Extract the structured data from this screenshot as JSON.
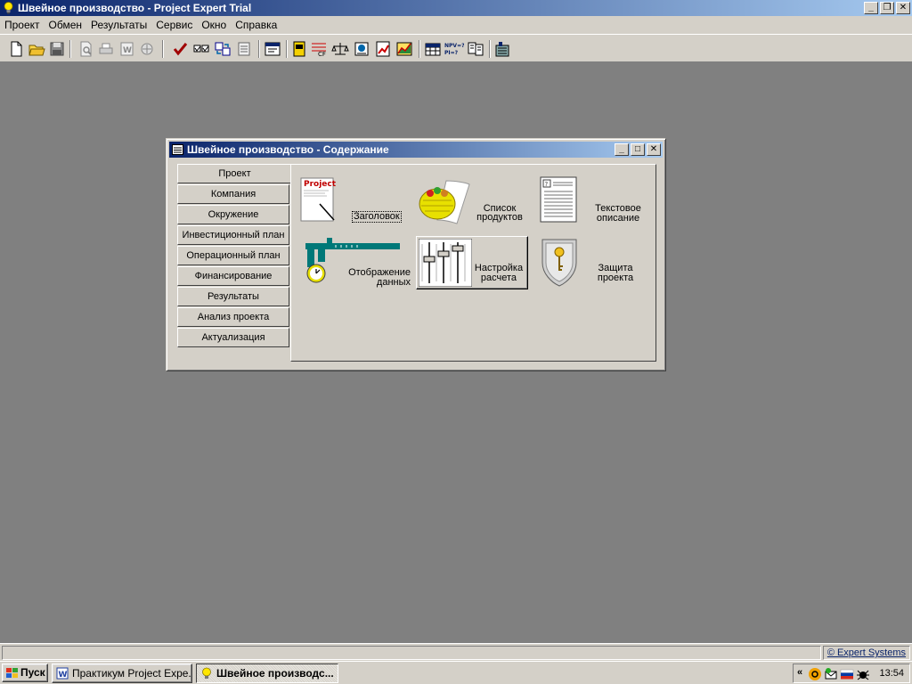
{
  "app": {
    "title": "Швейное производство - Project Expert Trial"
  },
  "menu": [
    "Проект",
    "Обмен",
    "Результаты",
    "Сервис",
    "Окно",
    "Справка"
  ],
  "content_window": {
    "title": "Швейное производство - Содержание",
    "nav": [
      "Проект",
      "Компания",
      "Окружение",
      "Инвестиционный план",
      "Операционный план",
      "Финансирование",
      "Результаты",
      "Анализ проекта",
      "Актуализация"
    ],
    "active_nav_index": 0,
    "tiles": {
      "header": {
        "label": "Заголовок",
        "icon_text": "Project"
      },
      "products": {
        "line1": "Список",
        "line2": "продуктов"
      },
      "text_desc": {
        "line1": "Текстовое",
        "line2": "описание"
      },
      "data_display": {
        "line1": "Отображение",
        "line2": "данных"
      },
      "calc_settings": {
        "line1": "Настройка",
        "line2": "расчета"
      },
      "protection": {
        "line1": "Защита",
        "line2": "проекта"
      }
    }
  },
  "statusbar": {
    "right_text": "© Expert Systems"
  },
  "taskbar": {
    "start_label": "Пуск",
    "tasks": [
      "Практикум Project Expe...",
      "Швейное производс..."
    ],
    "clock": "13:54"
  },
  "colors": {
    "titlebar_start": "#0a246a",
    "titlebar_end": "#a6caf0",
    "face": "#d4d0c8",
    "desktop": "#808080"
  }
}
